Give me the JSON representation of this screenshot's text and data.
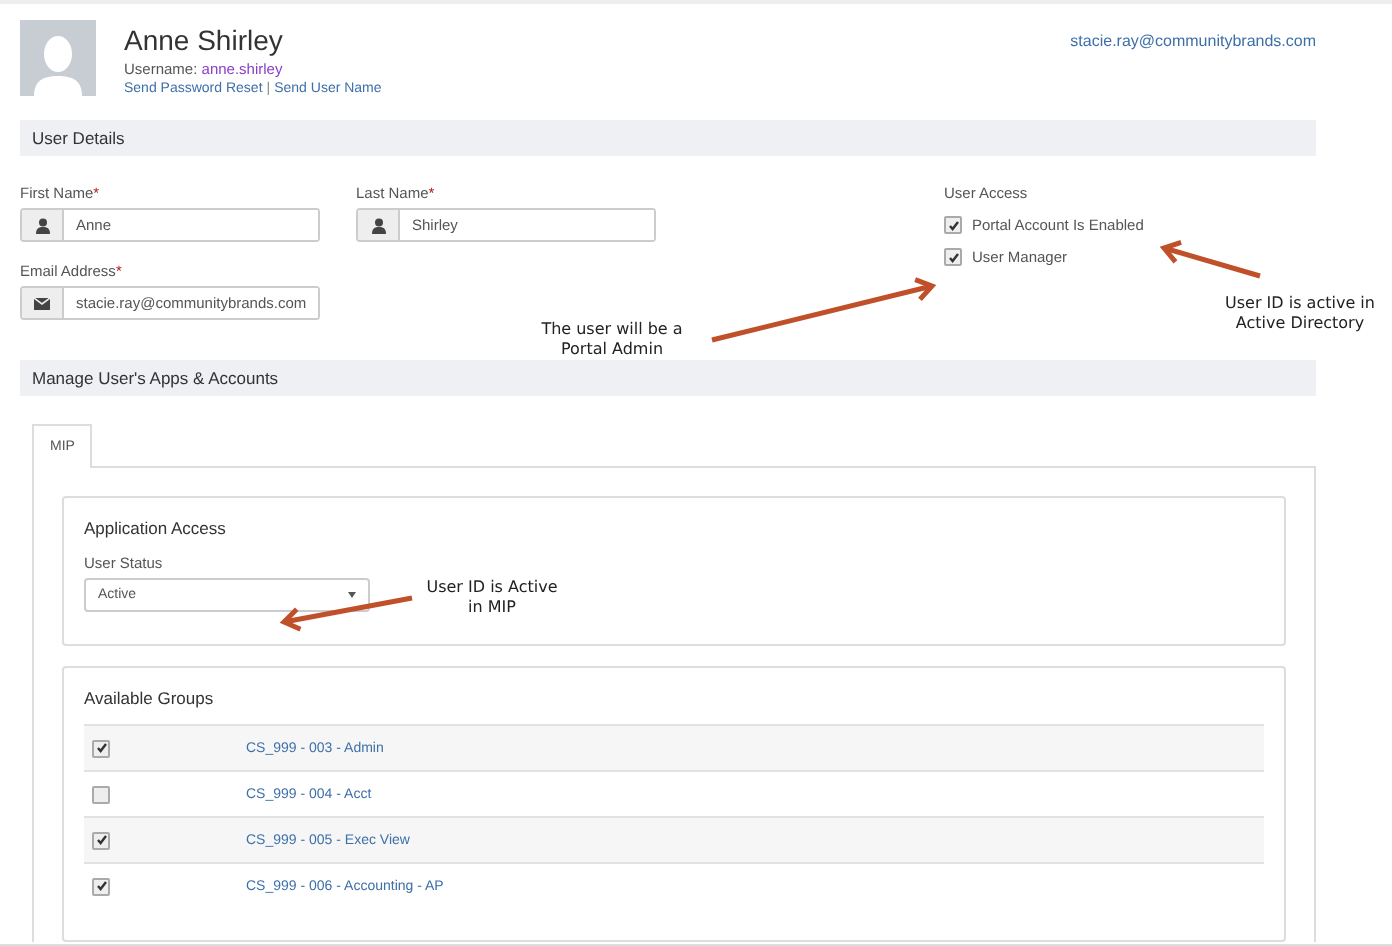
{
  "header": {
    "name": "Anne Shirley",
    "username_label": "Username:",
    "username": "anne.shirley",
    "links": [
      "Send Password Reset",
      "Send User Name"
    ],
    "separator": "|",
    "account_email": "stacie.ray@communitybrands.com"
  },
  "user_details": {
    "title": "User Details",
    "fields": [
      {
        "label": "First Name",
        "required_mark": "*",
        "value": "Anne",
        "kind": "person"
      },
      {
        "label": "Last Name",
        "required_mark": "*",
        "value": "Shirley",
        "kind": "person"
      },
      {
        "label": "Email Address",
        "required_mark": "*",
        "value": "stacie.ray@communitybrands.com",
        "kind": "mail"
      }
    ],
    "user_access": {
      "label": "User Access",
      "options": [
        {
          "label": "Portal Account Is Enabled",
          "checked": true
        },
        {
          "label": "User Manager",
          "checked": true
        }
      ]
    }
  },
  "apps": {
    "title": "Manage User's Apps & Accounts",
    "tabs": [
      {
        "label": "MIP",
        "selected": true
      }
    ],
    "application_access": {
      "title": "Application Access",
      "status_label": "User Status",
      "status_value": "Active"
    },
    "groups": {
      "title": "Available Groups",
      "rows": [
        {
          "name": "CS_999 - 003 - Admin",
          "checked": true
        },
        {
          "name": "CS_999 - 004 - Acct",
          "checked": false
        },
        {
          "name": "CS_999 - 005 - Exec View",
          "checked": true
        },
        {
          "name": "CS_999 - 006 - Accounting - AP",
          "checked": true
        }
      ]
    }
  },
  "annotations": [
    {
      "text": "The user will be a\nPortal Admin",
      "kind": "admin"
    },
    {
      "text": "User ID is active in\nActive Directory",
      "kind": "directory"
    },
    {
      "text": "User ID is Active\nin MIP",
      "kind": "mip"
    }
  ]
}
